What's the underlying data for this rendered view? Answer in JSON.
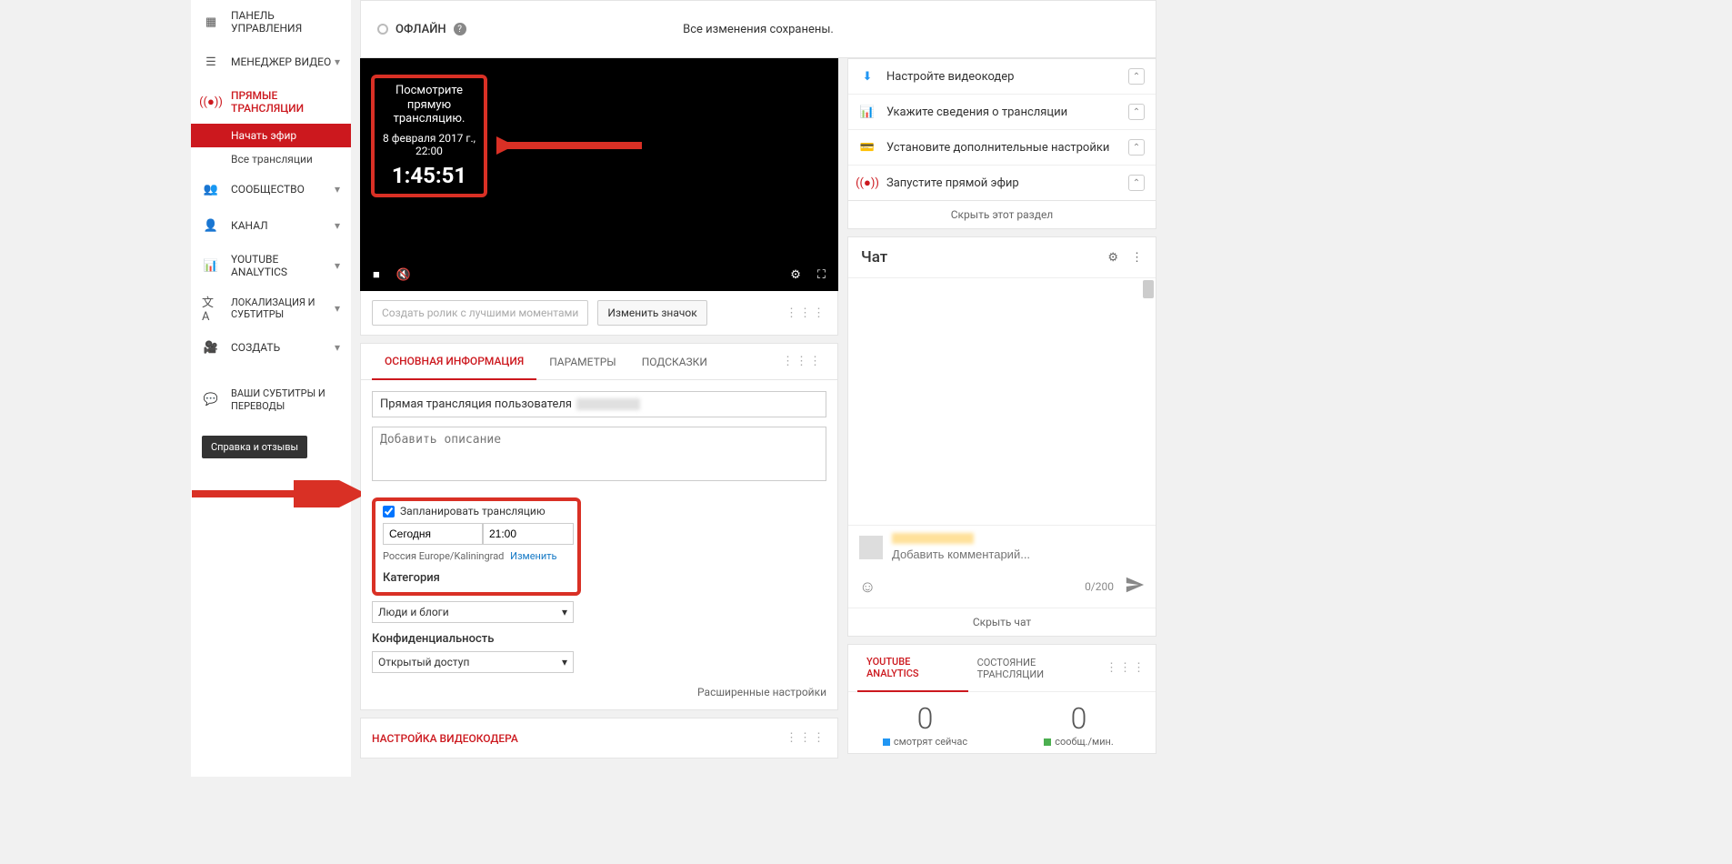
{
  "sidebar": {
    "items": [
      {
        "label": "ПАНЕЛЬ УПРАВЛЕНИЯ"
      },
      {
        "label": "МЕНЕДЖЕР ВИДЕО"
      },
      {
        "label": "ПРЯМЫЕ ТРАНСЛЯЦИИ"
      },
      {
        "label": "СООБЩЕСТВО"
      },
      {
        "label": "КАНАЛ"
      },
      {
        "label": "YOUTUBE ANALYTICS"
      },
      {
        "label": "ЛОКАЛИЗАЦИЯ И СУБТИТРЫ"
      },
      {
        "label": "СОЗДАТЬ"
      },
      {
        "label": "ВАШИ СУБТИТРЫ И ПЕРЕВОДЫ"
      }
    ],
    "live_sub": {
      "start": "Начать эфир",
      "all": "Все трансляции"
    },
    "help": "Справка и отзывы"
  },
  "status": {
    "offline": "ОФЛАЙН",
    "saved": "Все изменения сохранены."
  },
  "video": {
    "l1": "Посмотрите прямую трансляцию.",
    "l2": "8 февраля 2017 г., 22:00",
    "l3": "1:45:51"
  },
  "buttons": {
    "highlight": "Создать ролик с лучшими моментами",
    "thumb": "Изменить значок"
  },
  "tabs": {
    "a": "ОСНОВНАЯ ИНФОРМАЦИЯ",
    "b": "ПАРАМЕТРЫ",
    "c": "ПОДСКАЗКИ"
  },
  "form": {
    "title_prefix": "Прямая трансляция пользователя",
    "desc_ph": "Добавить описание",
    "sched_label": "Запланировать трансляцию",
    "date": "Сегодня",
    "time": "21:00",
    "tz_text": "Россия Europe/Kaliningrad",
    "tz_change": "Изменить",
    "cat_h": "Категория",
    "cat_v": "Люди и блоги",
    "priv_h": "Конфиденциальность",
    "priv_v": "Открытый доступ",
    "adv": "Расширенные настройки"
  },
  "encoder_panel": "НАСТРОЙКА ВИДЕОКОДЕРА",
  "checklist": {
    "a": "Настройте видеокодер",
    "b": "Укажите сведения о трансляции",
    "c": "Установите дополнительные настройки",
    "d": "Запустите прямой эфир",
    "hide": "Скрыть этот раздел"
  },
  "chat": {
    "title": "Чат",
    "placeholder": "Добавить комментарий...",
    "count": "0/200",
    "hide": "Скрыть чат"
  },
  "analytics": {
    "tab_a": "YOUTUBE ANALYTICS",
    "tab_b": "СОСТОЯНИЕ ТРАНСЛЯЦИИ",
    "stat_a_n": "0",
    "stat_a_l": "смотрят сейчас",
    "stat_b_n": "0",
    "stat_b_l": "сообщ./мин.",
    "colors": {
      "a": "#2196f3",
      "b": "#4caf50"
    }
  }
}
